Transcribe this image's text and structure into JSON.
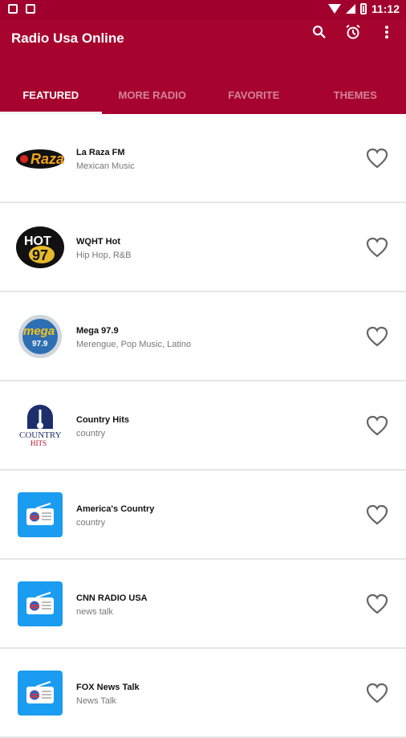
{
  "status": {
    "time": "11:12"
  },
  "app": {
    "title": "Radio Usa Online",
    "accent": "#a6042f"
  },
  "tabs": [
    {
      "label": "FEATURED",
      "active": true
    },
    {
      "label": "MORE RADIO",
      "active": false
    },
    {
      "label": "FAVORITE",
      "active": false
    },
    {
      "label": "THEMES",
      "active": false
    }
  ],
  "stations": [
    {
      "name": "La Raza FM",
      "genre": "Mexican Music",
      "logo": "la-raza-logo"
    },
    {
      "name": "WQHT Hot",
      "genre": " Hip Hop, R&B",
      "logo": "hot97-logo"
    },
    {
      "name": "Mega 97.9",
      "genre": "Merengue, Pop Music, Latino",
      "logo": "mega979-logo"
    },
    {
      "name": "Country Hits",
      "genre": "country",
      "logo": "country-hits-logo"
    },
    {
      "name": "America's Country",
      "genre": "country",
      "logo": "radio-tile-icon"
    },
    {
      "name": "CNN RADIO USA",
      "genre": "news  talk",
      "logo": "radio-tile-icon"
    },
    {
      "name": "FOX News Talk",
      "genre": "News Talk",
      "logo": "radio-tile-icon"
    }
  ],
  "logo_texts": {
    "la_raza": "Raza",
    "hot97_top": "HOT",
    "hot97_bottom": "97",
    "mega": "mega",
    "mega_freq": "97.9",
    "country_1": "COUNTRY",
    "country_2": "HITS"
  }
}
